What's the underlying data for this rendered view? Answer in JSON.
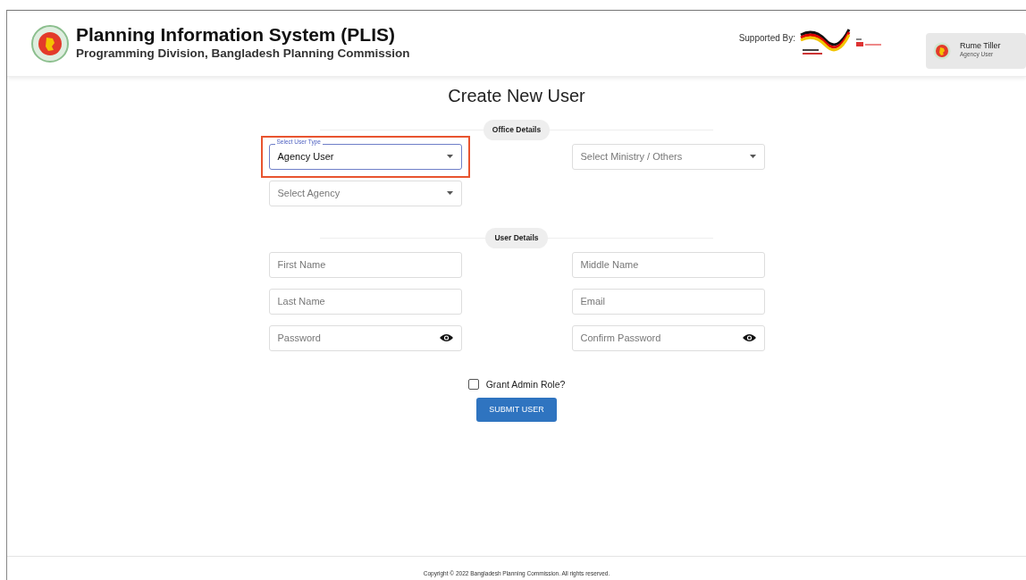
{
  "header": {
    "title": "Planning Information System (PLIS)",
    "subtitle": "Programming Division, Bangladesh Planning Commission",
    "supported_by": "Supported By:",
    "user": {
      "name": "Rume Tiller",
      "role": "Agency User"
    }
  },
  "form": {
    "title": "Create New User",
    "office_details": {
      "label": "Office Details",
      "fields": [
        {
          "kind": "select",
          "label": "Select User Type",
          "value": "Agency User",
          "highlighted": true
        },
        {
          "kind": "select",
          "placeholder": "Select Ministry / Others",
          "highlighted": false
        },
        {
          "kind": "select",
          "placeholder": "Select Agency",
          "highlighted": false
        }
      ]
    },
    "user_details": {
      "label": "User Details",
      "fields": [
        {
          "kind": "text",
          "placeholder": "First Name"
        },
        {
          "kind": "text",
          "placeholder": "Middle Name"
        },
        {
          "kind": "text",
          "placeholder": "Last Name"
        },
        {
          "kind": "text",
          "placeholder": "Email"
        },
        {
          "kind": "password",
          "placeholder": "Password"
        },
        {
          "kind": "password",
          "placeholder": "Confirm Password"
        }
      ]
    },
    "admin_checkbox": {
      "label": "Grant Admin Role?",
      "checked": false
    },
    "submit": "SUBMIT USER"
  },
  "footer": "Copyright © 2022 Bangladesh Planning Commission. All rights reserved."
}
